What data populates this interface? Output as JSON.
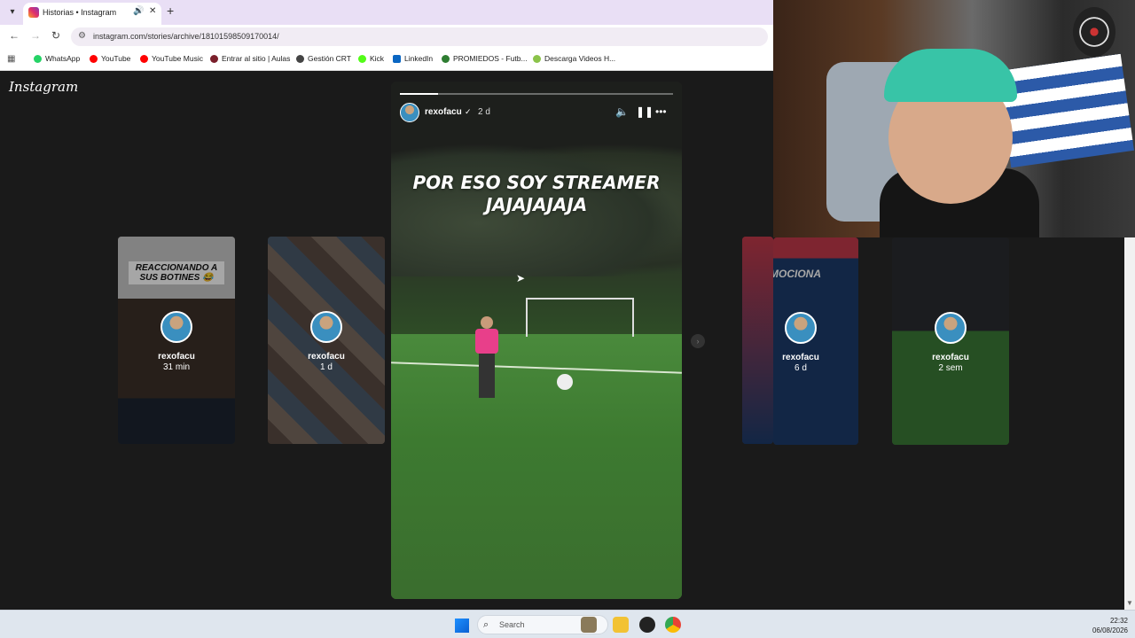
{
  "browser": {
    "tab_title": "Historias • Instagram",
    "url": "instagram.com/stories/archive/18101598509170014/",
    "bookmarks": [
      {
        "label": "WhatsApp",
        "color": "#25d366"
      },
      {
        "label": "YouTube",
        "color": "#ff0000"
      },
      {
        "label": "YouTube Music",
        "color": "#ff0000"
      },
      {
        "label": "Entrar al sitio | Aulas",
        "color": "#7a1f2b"
      },
      {
        "label": "Gestión CRT",
        "color": "#444444"
      },
      {
        "label": "Kick",
        "color": "#53fc18"
      },
      {
        "label": "LinkedIn",
        "color": "#0a66c2"
      },
      {
        "label": "PROMIEDOS - Futb...",
        "color": "#2e7d32"
      },
      {
        "label": "Descarga Videos H...",
        "color": "#8bc34a"
      }
    ]
  },
  "instagram": {
    "logo": "Instagram",
    "story": {
      "username": "rexofacu",
      "time": "2 d",
      "caption_line1": "POR ESO SOY STREAMER",
      "caption_line2": "JAJAJAJAJA",
      "progress": 0.14
    },
    "previews": [
      {
        "name": "rexofacu",
        "time": "31 min",
        "text": "REACCIONANDO A SUS BOTINES 😂"
      },
      {
        "name": "rexofacu",
        "time": "1 d"
      },
      {
        "name": "rexofacu",
        "time": "6 d",
        "text": "EMOCIONA"
      },
      {
        "name": "rexofacu",
        "time": "2 sem"
      }
    ]
  },
  "taskbar": {
    "search_label": "Search",
    "time": "22:32",
    "date": "06/08/2026"
  },
  "icons": {
    "audio": "speaker-icon",
    "pause": "pause-icon",
    "more": "more-icon"
  }
}
